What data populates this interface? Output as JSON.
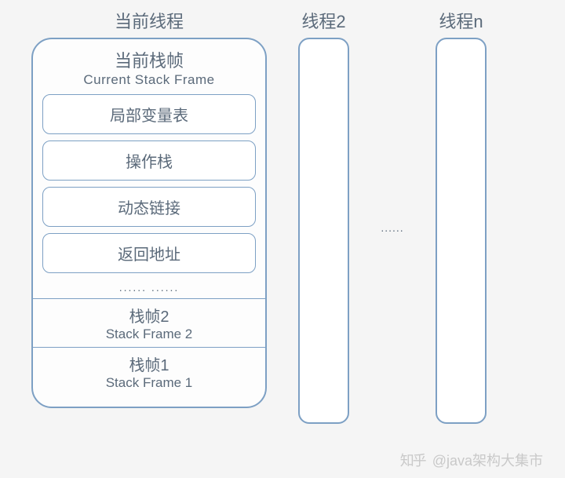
{
  "threads": {
    "current_label": "当前线程",
    "thread2_label": "线程2",
    "threadn_label": "线程n",
    "between_ellipsis": "......"
  },
  "current_frame": {
    "title_zh": "当前栈帧",
    "title_en": "Current Stack Frame",
    "items": {
      "local_vars": "局部变量表",
      "operand_stack": "操作栈",
      "dynamic_link": "动态链接",
      "return_addr": "返回地址"
    },
    "ellipsis": "...... ......"
  },
  "stack_frames": {
    "sf2_zh": "栈帧2",
    "sf2_en": "Stack Frame 2",
    "sf1_zh": "栈帧1",
    "sf1_en": "Stack Frame 1"
  },
  "watermark": {
    "logo": "知乎",
    "text": "@java架构大集市"
  }
}
